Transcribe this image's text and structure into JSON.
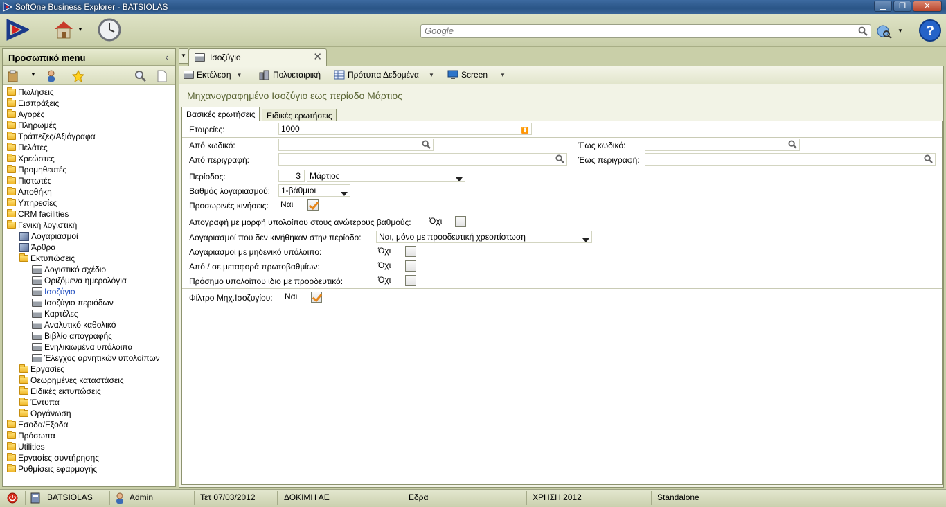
{
  "window": {
    "title": "SoftOne Business Explorer - BATSIOLAS"
  },
  "search": {
    "placeholder": "Google"
  },
  "left_panel": {
    "title": "Προσωπικό menu",
    "tree": [
      {
        "label": "Πωλήσεις",
        "level": 0,
        "icon": "folder"
      },
      {
        "label": "Εισπράξεις",
        "level": 0,
        "icon": "folder"
      },
      {
        "label": "Αγορές",
        "level": 0,
        "icon": "folder"
      },
      {
        "label": "Πληρωμές",
        "level": 0,
        "icon": "folder"
      },
      {
        "label": "Τράπεζες/Αξιόγραφα",
        "level": 0,
        "icon": "folder"
      },
      {
        "label": "Πελάτες",
        "level": 0,
        "icon": "folder"
      },
      {
        "label": "Χρεώστες",
        "level": 0,
        "icon": "folder"
      },
      {
        "label": "Προμηθευτές",
        "level": 0,
        "icon": "folder"
      },
      {
        "label": "Πιστωτές",
        "level": 0,
        "icon": "folder"
      },
      {
        "label": "Αποθήκη",
        "level": 0,
        "icon": "folder"
      },
      {
        "label": "Υπηρεσίες",
        "level": 0,
        "icon": "folder"
      },
      {
        "label": "CRM facilities",
        "level": 0,
        "icon": "folder"
      },
      {
        "label": "Γενική λογιστική",
        "level": 0,
        "icon": "folder"
      },
      {
        "label": "Λογαριασμοί",
        "level": 1,
        "icon": "cube"
      },
      {
        "label": "Άρθρα",
        "level": 1,
        "icon": "cube"
      },
      {
        "label": "Εκτυπώσεις",
        "level": 1,
        "icon": "folder"
      },
      {
        "label": "Λογιστικό σχέδιο",
        "level": 2,
        "icon": "printer"
      },
      {
        "label": "Οριζόμενα ημερολόγια",
        "level": 2,
        "icon": "printer"
      },
      {
        "label": "Ισοζύγιο",
        "level": 2,
        "icon": "printer",
        "selected": true
      },
      {
        "label": "Ισοζύγιο περιόδων",
        "level": 2,
        "icon": "printer"
      },
      {
        "label": "Καρτέλες",
        "level": 2,
        "icon": "printer"
      },
      {
        "label": "Αναλυτικό καθολικό",
        "level": 2,
        "icon": "printer"
      },
      {
        "label": "Βιβλίο απογραφής",
        "level": 2,
        "icon": "printer"
      },
      {
        "label": "Ενηλικιωμένα υπόλοιπα",
        "level": 2,
        "icon": "printer"
      },
      {
        "label": "Έλεγχος αρνητικών υπολοίπων",
        "level": 2,
        "icon": "printer"
      },
      {
        "label": "Εργασίες",
        "level": 1,
        "icon": "folder"
      },
      {
        "label": "Θεωρημένες καταστάσεις",
        "level": 1,
        "icon": "folder"
      },
      {
        "label": "Ειδικές εκτυπώσεις",
        "level": 1,
        "icon": "folder"
      },
      {
        "label": "Έντυπα",
        "level": 1,
        "icon": "folder"
      },
      {
        "label": "Οργάνωση",
        "level": 1,
        "icon": "folder"
      },
      {
        "label": "Εσοδα/Εξοδα",
        "level": 0,
        "icon": "folder"
      },
      {
        "label": "Πρόσωπα",
        "level": 0,
        "icon": "folder"
      },
      {
        "label": "Utilities",
        "level": 0,
        "icon": "folder"
      },
      {
        "label": "Εργασίες συντήρησης",
        "level": 0,
        "icon": "folder"
      },
      {
        "label": "Ρυθμίσεις εφαρμογής",
        "level": 0,
        "icon": "folder"
      }
    ]
  },
  "doc_tab": {
    "title": "Ισοζύγιο"
  },
  "actions": {
    "run": "Εκτέλεση",
    "multi": "Πολυεταιρική",
    "templates": "Πρότυπα Δεδομένα",
    "screen": "Screen"
  },
  "heading": "Μηχανογραφημένο Ισοζύγιο εως περίοδο  Μάρτιος",
  "query_tabs": {
    "basic": "Βασικές ερωτήσεις",
    "special": "Ειδικές ερωτήσεις"
  },
  "form": {
    "companies_label": "Εταιρείες:",
    "companies_value": "1000",
    "from_code_label": "Από κωδικό:",
    "to_code_label": "Έως κωδικό:",
    "from_desc_label": "Από περιγραφή:",
    "to_desc_label": "Έως περιγραφή:",
    "period_label": "Περίοδος:",
    "period_num": "3",
    "period_name": "Μάρτιος",
    "grade_label": "Βαθμός λογαριασμού:",
    "grade_value": "1-βάθμιοι",
    "temp_label": "Προσωρινές κινήσεις:",
    "temp_value": "Ναι",
    "inventory_label": "Απογραφή με μορφή υπολοίπου στους ανώτερους βαθμούς:",
    "inventory_value": "Όχι",
    "unmoved_label": "Λογαριασμοί που δεν κινήθηκαν στην περίοδο:",
    "unmoved_value": "Ναι, μόνο με προοδευτική χρεοπίστωση",
    "zero_label": "Λογαριασμοί με μηδενικό υπόλοιπο:",
    "zero_value": "Όχι",
    "transfer_label": "Από / σε μεταφορά πρωτοβαθμίων:",
    "transfer_value": "Όχι",
    "sign_label": "Πρόσημο υπολοίπου ίδιο με προοδευτικό:",
    "sign_value": "Όχι",
    "filter_label": "Φίλτρο Μηχ.Ισοζυγίου:",
    "filter_value": "Ναι"
  },
  "status": {
    "company": "BATSIOLAS",
    "user": "Admin",
    "date": "Τετ 07/03/2012",
    "firm": "ΔΟΚΙΜΗ ΑΕ",
    "branch": "Εδρα",
    "year": "ΧΡΗΣΗ 2012",
    "mode": "Standalone"
  },
  "colors": {
    "accent": "#1f4dbf",
    "panel": "#c9cfa8",
    "check": "#e6861b"
  }
}
